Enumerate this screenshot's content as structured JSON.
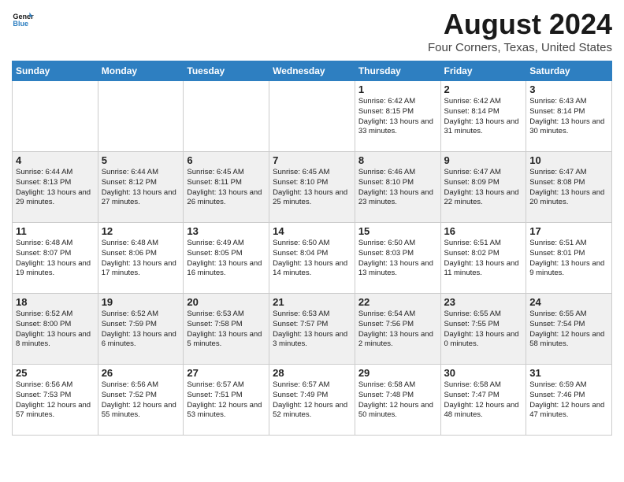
{
  "header": {
    "logo_general": "General",
    "logo_blue": "Blue",
    "month": "August 2024",
    "location": "Four Corners, Texas, United States"
  },
  "days_of_week": [
    "Sunday",
    "Monday",
    "Tuesday",
    "Wednesday",
    "Thursday",
    "Friday",
    "Saturday"
  ],
  "weeks": [
    [
      {
        "day": "",
        "info": ""
      },
      {
        "day": "",
        "info": ""
      },
      {
        "day": "",
        "info": ""
      },
      {
        "day": "",
        "info": ""
      },
      {
        "day": "1",
        "info": "Sunrise: 6:42 AM\nSunset: 8:15 PM\nDaylight: 13 hours\nand 33 minutes."
      },
      {
        "day": "2",
        "info": "Sunrise: 6:42 AM\nSunset: 8:14 PM\nDaylight: 13 hours\nand 31 minutes."
      },
      {
        "day": "3",
        "info": "Sunrise: 6:43 AM\nSunset: 8:14 PM\nDaylight: 13 hours\nand 30 minutes."
      }
    ],
    [
      {
        "day": "4",
        "info": "Sunrise: 6:44 AM\nSunset: 8:13 PM\nDaylight: 13 hours\nand 29 minutes."
      },
      {
        "day": "5",
        "info": "Sunrise: 6:44 AM\nSunset: 8:12 PM\nDaylight: 13 hours\nand 27 minutes."
      },
      {
        "day": "6",
        "info": "Sunrise: 6:45 AM\nSunset: 8:11 PM\nDaylight: 13 hours\nand 26 minutes."
      },
      {
        "day": "7",
        "info": "Sunrise: 6:45 AM\nSunset: 8:10 PM\nDaylight: 13 hours\nand 25 minutes."
      },
      {
        "day": "8",
        "info": "Sunrise: 6:46 AM\nSunset: 8:10 PM\nDaylight: 13 hours\nand 23 minutes."
      },
      {
        "day": "9",
        "info": "Sunrise: 6:47 AM\nSunset: 8:09 PM\nDaylight: 13 hours\nand 22 minutes."
      },
      {
        "day": "10",
        "info": "Sunrise: 6:47 AM\nSunset: 8:08 PM\nDaylight: 13 hours\nand 20 minutes."
      }
    ],
    [
      {
        "day": "11",
        "info": "Sunrise: 6:48 AM\nSunset: 8:07 PM\nDaylight: 13 hours\nand 19 minutes."
      },
      {
        "day": "12",
        "info": "Sunrise: 6:48 AM\nSunset: 8:06 PM\nDaylight: 13 hours\nand 17 minutes."
      },
      {
        "day": "13",
        "info": "Sunrise: 6:49 AM\nSunset: 8:05 PM\nDaylight: 13 hours\nand 16 minutes."
      },
      {
        "day": "14",
        "info": "Sunrise: 6:50 AM\nSunset: 8:04 PM\nDaylight: 13 hours\nand 14 minutes."
      },
      {
        "day": "15",
        "info": "Sunrise: 6:50 AM\nSunset: 8:03 PM\nDaylight: 13 hours\nand 13 minutes."
      },
      {
        "day": "16",
        "info": "Sunrise: 6:51 AM\nSunset: 8:02 PM\nDaylight: 13 hours\nand 11 minutes."
      },
      {
        "day": "17",
        "info": "Sunrise: 6:51 AM\nSunset: 8:01 PM\nDaylight: 13 hours\nand 9 minutes."
      }
    ],
    [
      {
        "day": "18",
        "info": "Sunrise: 6:52 AM\nSunset: 8:00 PM\nDaylight: 13 hours\nand 8 minutes."
      },
      {
        "day": "19",
        "info": "Sunrise: 6:52 AM\nSunset: 7:59 PM\nDaylight: 13 hours\nand 6 minutes."
      },
      {
        "day": "20",
        "info": "Sunrise: 6:53 AM\nSunset: 7:58 PM\nDaylight: 13 hours\nand 5 minutes."
      },
      {
        "day": "21",
        "info": "Sunrise: 6:53 AM\nSunset: 7:57 PM\nDaylight: 13 hours\nand 3 minutes."
      },
      {
        "day": "22",
        "info": "Sunrise: 6:54 AM\nSunset: 7:56 PM\nDaylight: 13 hours\nand 2 minutes."
      },
      {
        "day": "23",
        "info": "Sunrise: 6:55 AM\nSunset: 7:55 PM\nDaylight: 13 hours\nand 0 minutes."
      },
      {
        "day": "24",
        "info": "Sunrise: 6:55 AM\nSunset: 7:54 PM\nDaylight: 12 hours\nand 58 minutes."
      }
    ],
    [
      {
        "day": "25",
        "info": "Sunrise: 6:56 AM\nSunset: 7:53 PM\nDaylight: 12 hours\nand 57 minutes."
      },
      {
        "day": "26",
        "info": "Sunrise: 6:56 AM\nSunset: 7:52 PM\nDaylight: 12 hours\nand 55 minutes."
      },
      {
        "day": "27",
        "info": "Sunrise: 6:57 AM\nSunset: 7:51 PM\nDaylight: 12 hours\nand 53 minutes."
      },
      {
        "day": "28",
        "info": "Sunrise: 6:57 AM\nSunset: 7:49 PM\nDaylight: 12 hours\nand 52 minutes."
      },
      {
        "day": "29",
        "info": "Sunrise: 6:58 AM\nSunset: 7:48 PM\nDaylight: 12 hours\nand 50 minutes."
      },
      {
        "day": "30",
        "info": "Sunrise: 6:58 AM\nSunset: 7:47 PM\nDaylight: 12 hours\nand 48 minutes."
      },
      {
        "day": "31",
        "info": "Sunrise: 6:59 AM\nSunset: 7:46 PM\nDaylight: 12 hours\nand 47 minutes."
      }
    ]
  ]
}
